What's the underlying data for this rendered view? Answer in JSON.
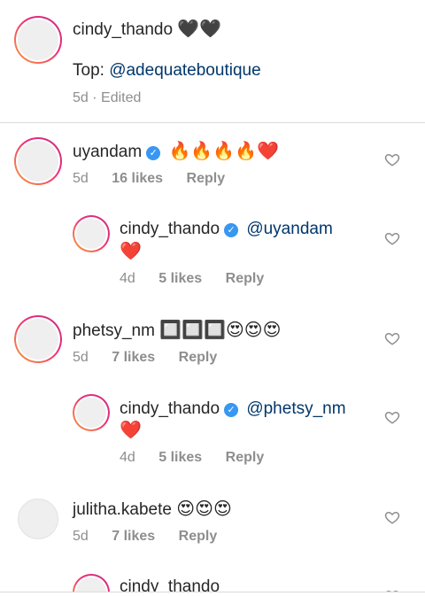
{
  "caption": {
    "username": "cindy_thando",
    "username_emoji": "🖤🖤",
    "text_prefix": "Top: ",
    "mention": "@adequateboutique",
    "time": "5d",
    "edited": "· Edited"
  },
  "comments": [
    {
      "username": "uyandam",
      "verified": true,
      "text": "🔥🔥🔥🔥❤️",
      "time": "5d",
      "likes": "16 likes",
      "reply_label": "Reply"
    },
    {
      "username": "cindy_thando",
      "verified": true,
      "mention": "@uyandam",
      "text": "❤️",
      "time": "4d",
      "likes": "5 likes",
      "reply_label": "Reply"
    },
    {
      "username": "phetsy_nm",
      "verified": false,
      "text": "🔲🔲🔲😍😍😍",
      "time": "5d",
      "likes": "7 likes",
      "reply_label": "Reply"
    },
    {
      "username": "cindy_thando",
      "verified": true,
      "mention": "@phetsy_nm",
      "text": "❤️",
      "time": "4d",
      "likes": "5 likes",
      "reply_label": "Reply"
    },
    {
      "username": "julitha.kabete",
      "verified": false,
      "text": "😍😍😍",
      "time": "5d",
      "likes": "7 likes",
      "reply_label": "Reply"
    },
    {
      "username": "cindy_thando",
      "verified": false,
      "text": ""
    }
  ],
  "icons": {
    "like": "heart-outline-icon",
    "verified": "verified-badge-icon"
  },
  "colors": {
    "mention": "#00376b",
    "verified": "#3897f0",
    "meta": "#8e8e8e"
  }
}
